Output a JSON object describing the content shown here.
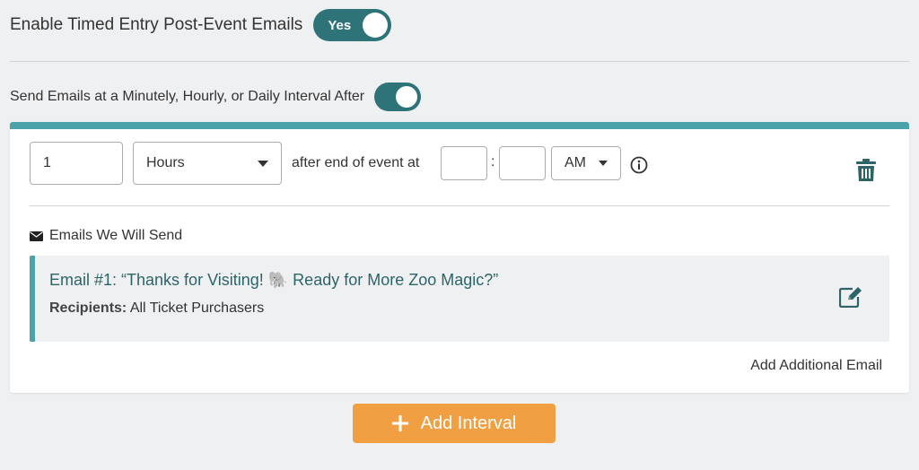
{
  "header": {
    "title": "Enable Timed Entry Post-Event Emails",
    "toggle_label": "Yes"
  },
  "interval_section": {
    "title": "Send Emails at a Minutely, Hourly, or Daily Interval After"
  },
  "interval": {
    "amount": "1",
    "unit": "Hours",
    "after_text": "after end of event at",
    "hour": "",
    "colon": ":",
    "minute": "",
    "ampm": "AM"
  },
  "emails": {
    "heading": "Emails We Will Send",
    "items": [
      {
        "title": "Email #1: “Thanks for Visiting! 🐘 Ready for More Zoo Magic?”",
        "recipients_label": "Recipients:",
        "recipients_value": "All Ticket Purchasers"
      }
    ],
    "add_label": "Add Additional Email"
  },
  "add_interval": {
    "icon": "+",
    "label": "Add Interval"
  },
  "colors": {
    "teal_dark": "#2d7378",
    "teal_accent": "#4ba2a8",
    "orange": "#f0a042",
    "background": "#eff0f2"
  }
}
